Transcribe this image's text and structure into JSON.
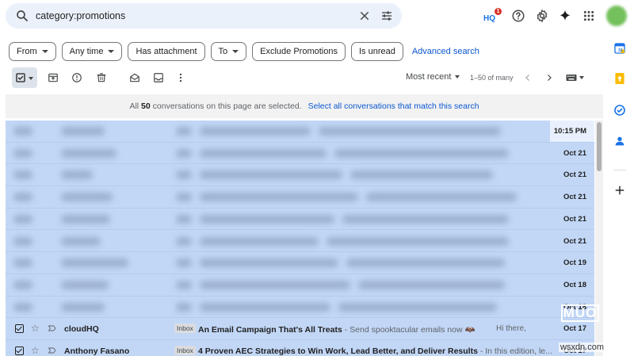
{
  "search": {
    "query": "category:promotions"
  },
  "header": {
    "hq_badge_count": "1",
    "hq_badge_text": "HQ"
  },
  "filters": {
    "chips": [
      "From",
      "Any time",
      "Has attachment",
      "To",
      "Exclude Promotions",
      "Is unread"
    ],
    "advanced_search_label": "Advanced search"
  },
  "toolbar": {
    "sort_label": "Most recent",
    "page_count": "1–50 of many"
  },
  "banner": {
    "prefix": "All",
    "count": "50",
    "suffix": "conversations on this page are selected.",
    "select_all_link": "Select all conversations that match this search"
  },
  "messages": [
    {
      "date": "10:15 PM"
    },
    {
      "date": "Oct 21"
    },
    {
      "date": "Oct 21"
    },
    {
      "date": "Oct 21"
    },
    {
      "date": "Oct 21"
    },
    {
      "date": "Oct 21"
    },
    {
      "date": "Oct 19"
    },
    {
      "date": "Oct 18"
    },
    {
      "date": "Oct 18"
    },
    {
      "sender": "cloudHQ",
      "label": "Inbox",
      "subject": "An Email Campaign That's All Treats",
      "snippet": " - Send spooktacular emails now 🦇",
      "snippet2": "Hi there,",
      "date": "Oct 17"
    },
    {
      "sender": "Anthony Fasano",
      "label": "Inbox",
      "subject": "4 Proven AEC Strategies to Win Work, Lead Better, and Deliver Results",
      "snippet": " - In this edition, le...",
      "date": "Oct 17"
    }
  ],
  "watermarks": {
    "brand": "MUO",
    "site": "wsxdn.com"
  },
  "colors": {
    "selected_row": "#c2d7f6",
    "search_bg": "#eaf1fb",
    "link": "#0b57d0"
  }
}
